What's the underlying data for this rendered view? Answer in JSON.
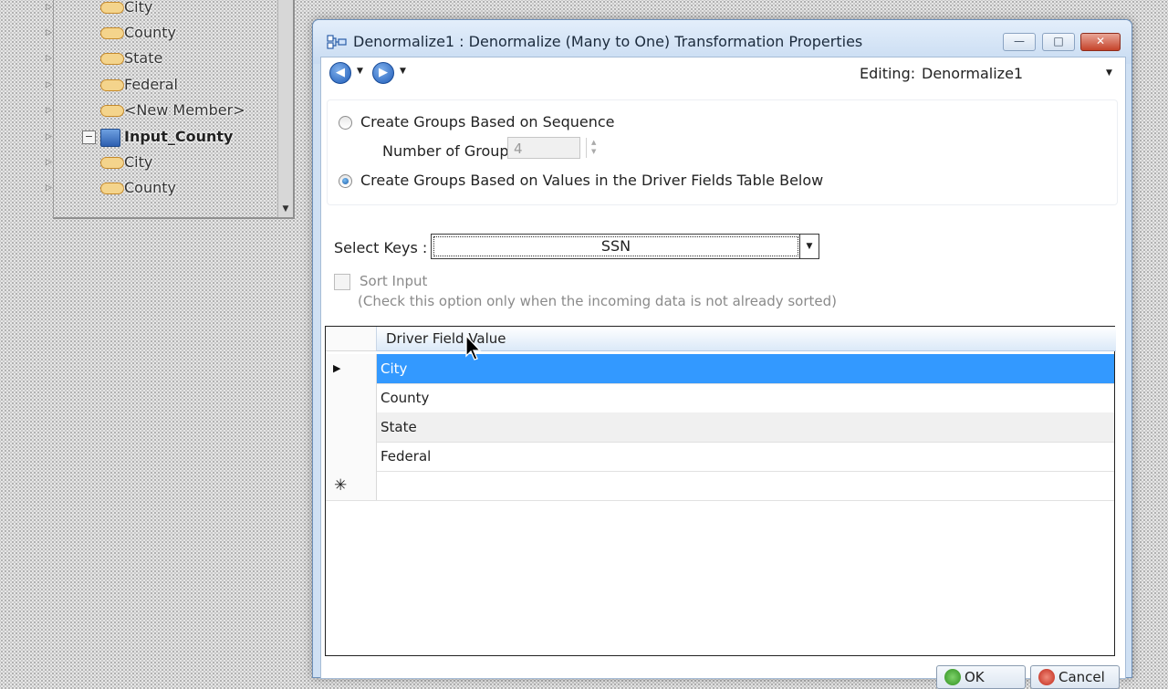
{
  "tree": {
    "rows": [
      {
        "label": "City",
        "type": "field"
      },
      {
        "label": "County",
        "type": "field"
      },
      {
        "label": "State",
        "type": "field"
      },
      {
        "label": "Federal",
        "type": "field"
      },
      {
        "label": "<New Member>",
        "type": "field"
      },
      {
        "label": "Input_County",
        "type": "group"
      },
      {
        "label": "City",
        "type": "field"
      },
      {
        "label": "County",
        "type": "field"
      }
    ]
  },
  "dialog": {
    "title": "Denormalize1 : Denormalize (Many to One) Transformation Properties",
    "window_buttons": {
      "minimize": "—",
      "maximize": "□",
      "close": "✕"
    },
    "editing_label": "Editing:",
    "editing_value": "Denormalize1",
    "grouping": {
      "option_sequence": "Create Groups Based on Sequence",
      "number_of_groups_label": "Number of Groups",
      "number_of_groups_value": "4",
      "option_values": "Create Groups Based on Values in the Driver Fields Table Below",
      "selected": "values"
    },
    "select_keys_label": "Select Keys :",
    "select_keys_value": "SSN",
    "sort_input_label": "Sort Input",
    "sort_input_note": "(Check this option only when the incoming data is not already sorted)",
    "sort_input_checked": false,
    "grid": {
      "column_header": "Driver Field Value",
      "rows": [
        "City",
        "County",
        "State",
        "Federal"
      ],
      "selected_row": 0,
      "new_row_marker": "✳"
    },
    "buttons": {
      "ok": "OK",
      "cancel": "Cancel"
    }
  },
  "colors": {
    "selection": "#3399ff",
    "title_bar": "#c9dcf2",
    "field_icon": "#f4d48c"
  },
  "icons": [
    "transform-icon",
    "back-arrow-icon",
    "forward-arrow-icon",
    "field-icon",
    "group-icon",
    "dropdown-arrow-icon",
    "row-pointer-icon",
    "new-row-icon",
    "mouse-cursor-icon"
  ]
}
